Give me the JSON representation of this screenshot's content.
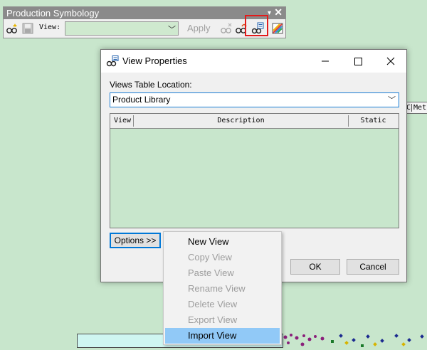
{
  "toolbar": {
    "title": "Production Symbology",
    "view_label": "View:",
    "view_value": "",
    "apply_label": "Apply",
    "icons": [
      "new-view-icon",
      "save-view-icon",
      "delete-view-icon",
      "refresh-view-icon",
      "view-properties-icon",
      "symbology-icon"
    ]
  },
  "background": {
    "fragment_texts": [
      "C",
      "Met"
    ]
  },
  "dialog": {
    "title": "View Properties",
    "location_label": "Views Table Location:",
    "location_value": "Product Library",
    "table": {
      "columns": [
        "View",
        "Description",
        "Static"
      ],
      "rows": []
    },
    "options_button": "Options >>",
    "ok_button": "OK",
    "cancel_button": "Cancel"
  },
  "context_menu": {
    "items": [
      {
        "label": "New View",
        "enabled": true
      },
      {
        "label": "Copy View",
        "enabled": false
      },
      {
        "label": "Paste View",
        "enabled": false
      },
      {
        "label": "Rename View",
        "enabled": false
      },
      {
        "label": "Delete View",
        "enabled": false
      },
      {
        "label": "Export View",
        "enabled": false
      },
      {
        "label": "Import View",
        "enabled": true,
        "highlighted": true
      }
    ]
  },
  "colors": {
    "background": "#c8e6cc",
    "highlight_border": "#e21b1b",
    "menu_highlight": "#91c9f7",
    "focus_blue": "#0078d7"
  }
}
